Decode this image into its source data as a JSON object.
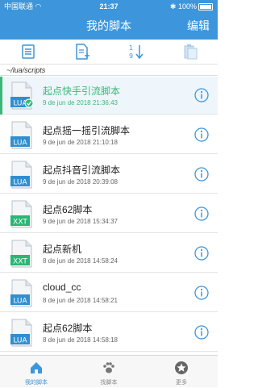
{
  "status_bar": {
    "carrier": "中国联通",
    "time": "21:37",
    "battery": "100%"
  },
  "nav": {
    "title": "我的脚本",
    "edit_label": "编辑"
  },
  "toolbar": {
    "icons": [
      "script-list-icon",
      "new-file-icon",
      "sort-icon",
      "paste-icon"
    ]
  },
  "path": "~/lua/scripts",
  "files": [
    {
      "name": "起点快手引流脚本",
      "date": "9 de jun de 2018 21:36:43",
      "type": "LUA",
      "selected": true
    },
    {
      "name": "起点摇一摇引流脚本",
      "date": "9 de jun de 2018 21:10:18",
      "type": "LUA",
      "selected": false
    },
    {
      "name": "起点抖音引流脚本",
      "date": "9 de jun de 2018 20:39:08",
      "type": "LUA",
      "selected": false
    },
    {
      "name": "起点62脚本",
      "date": "9 de jun de 2018 15:34:37",
      "type": "XXT",
      "selected": false
    },
    {
      "name": "起点新机",
      "date": "8 de jun de 2018 14:58:24",
      "type": "XXT",
      "selected": false
    },
    {
      "name": "cloud_cc",
      "date": "8 de jun de 2018 14:58:21",
      "type": "LUA",
      "selected": false
    },
    {
      "name": "起点62脚本",
      "date": "8 de jun de 2018 14:58:18",
      "type": "LUA",
      "selected": false
    }
  ],
  "tabs": [
    {
      "label": "我的脚本",
      "icon": "home-icon",
      "active": true
    },
    {
      "label": "找脚本",
      "icon": "paw-icon",
      "active": false
    },
    {
      "label": "更多",
      "icon": "star-icon",
      "active": false
    }
  ],
  "colors": {
    "header": "#3d96db",
    "lua_badge": "#2f8fd1",
    "xxt_badge": "#2bb673",
    "selected_text": "#3cb878"
  }
}
